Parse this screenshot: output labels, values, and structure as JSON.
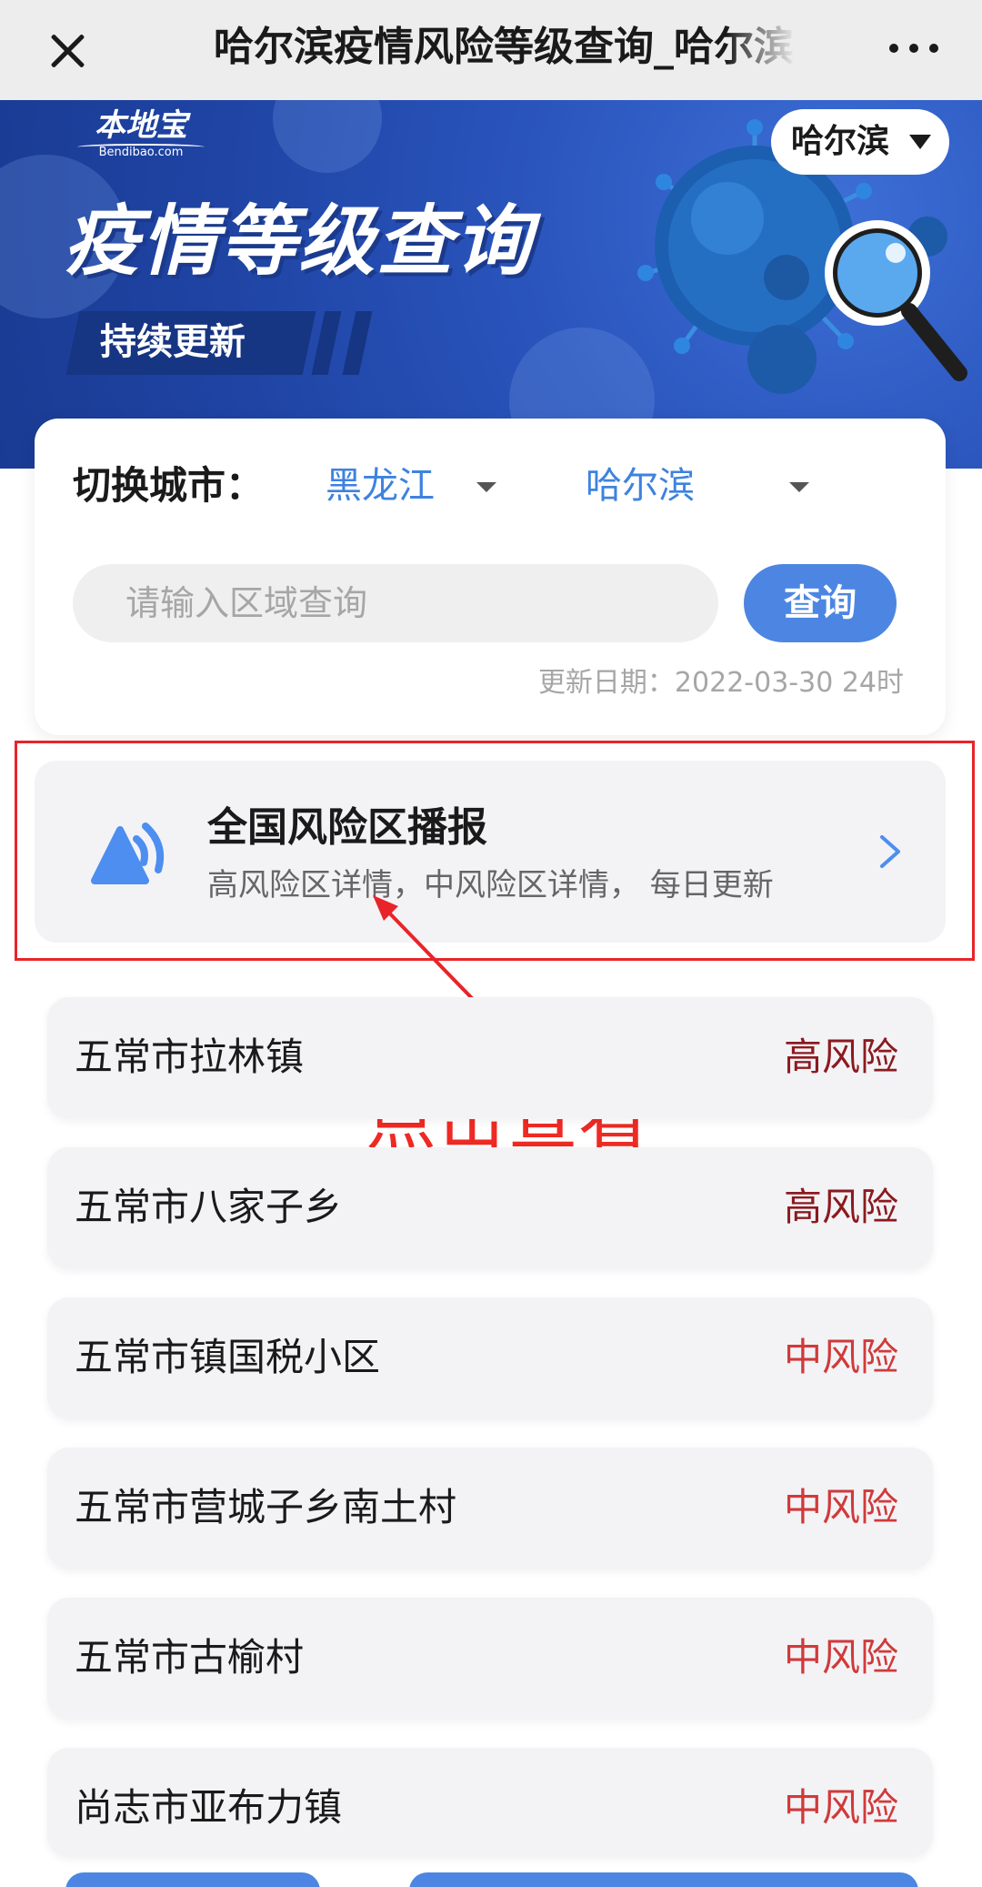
{
  "nav": {
    "title": "哈尔滨疫情风险等级查询_哈尔滨本地宝",
    "close_icon": "close-icon",
    "more_icon": "more-dots-icon"
  },
  "banner": {
    "logo_text": "本地宝",
    "logo_sub": "Bendibao.com",
    "title": "疫情等级查询",
    "tag": "持续更新",
    "city_pill": "哈尔滨",
    "background_color": "#2a55bd"
  },
  "query": {
    "switch_label": "切换城市：",
    "province": "黑龙江",
    "city": "哈尔滨",
    "search_placeholder": "请输入区域查询",
    "search_button": "查询",
    "update_date": "更新日期：2022-03-30 24时",
    "accent_color": "#4c86e2"
  },
  "broadcast": {
    "icon": "broadcast-speaker-icon",
    "title": "全国风险区播报",
    "subtitle": "高风险区详情，中风险区详情， 每日更新"
  },
  "annotation": {
    "label": "点击查看",
    "color": "#ee2a24"
  },
  "risk_list": [
    {
      "name": "五常市拉林镇",
      "level": "高风险",
      "color": "#8b1a1f"
    },
    {
      "name": "五常市八家子乡",
      "level": "高风险",
      "color": "#8b1a1f"
    },
    {
      "name": "五常市镇国税小区",
      "level": "中风险",
      "color": "#d03a3a"
    },
    {
      "name": "五常市营城子乡南土村",
      "level": "中风险",
      "color": "#d03a3a"
    },
    {
      "name": "五常市古榆村",
      "level": "中风险",
      "color": "#d03a3a"
    },
    {
      "name": "尚志市亚布力镇",
      "level": "中风险",
      "color": "#d03a3a"
    }
  ]
}
